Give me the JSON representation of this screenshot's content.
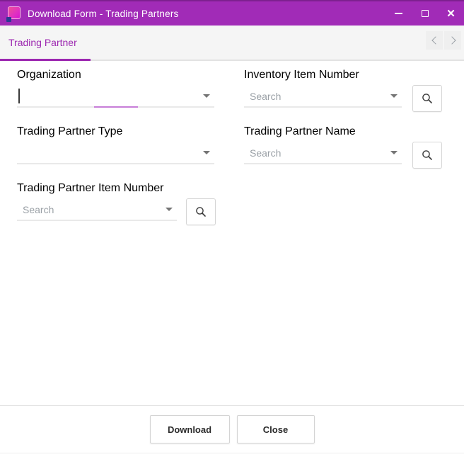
{
  "window": {
    "title": "Download Form - Trading Partners",
    "controls": {
      "minimize_icon": "minimize-dash",
      "maximize_icon": "maximize-square",
      "close_icon": "close-x",
      "close_glyph": "✕"
    },
    "app_icon": "gradient-squares-logo",
    "titlebar_color": "#A12BB7"
  },
  "tabs": {
    "items": [
      {
        "label": "Trading Partner",
        "active": true
      }
    ],
    "nav": {
      "prev_icon": "chevron-left",
      "next_icon": "chevron-right"
    },
    "accent_color": "#9C27B0"
  },
  "form": {
    "fields": [
      {
        "id": "organization",
        "label": "Organization",
        "value": "",
        "placeholder": "",
        "focused": true,
        "has_search_button": false
      },
      {
        "id": "inventory-item-number",
        "label": "Inventory Item Number",
        "value": "",
        "placeholder": "Search",
        "focused": false,
        "has_search_button": true
      },
      {
        "id": "trading-partner-type",
        "label": "Trading Partner Type",
        "value": "",
        "placeholder": "",
        "focused": false,
        "has_search_button": false
      },
      {
        "id": "trading-partner-name",
        "label": "Trading Partner Name",
        "value": "",
        "placeholder": "Search",
        "focused": false,
        "has_search_button": true
      },
      {
        "id": "trading-partner-item-number",
        "label": "Trading Partner Item Number",
        "value": "",
        "placeholder": "Search",
        "focused": false,
        "has_search_button": true
      }
    ],
    "search_icon": "magnifier",
    "dropdown_icon": "caret-down"
  },
  "footer": {
    "download_label": "Download",
    "close_label": "Close"
  }
}
